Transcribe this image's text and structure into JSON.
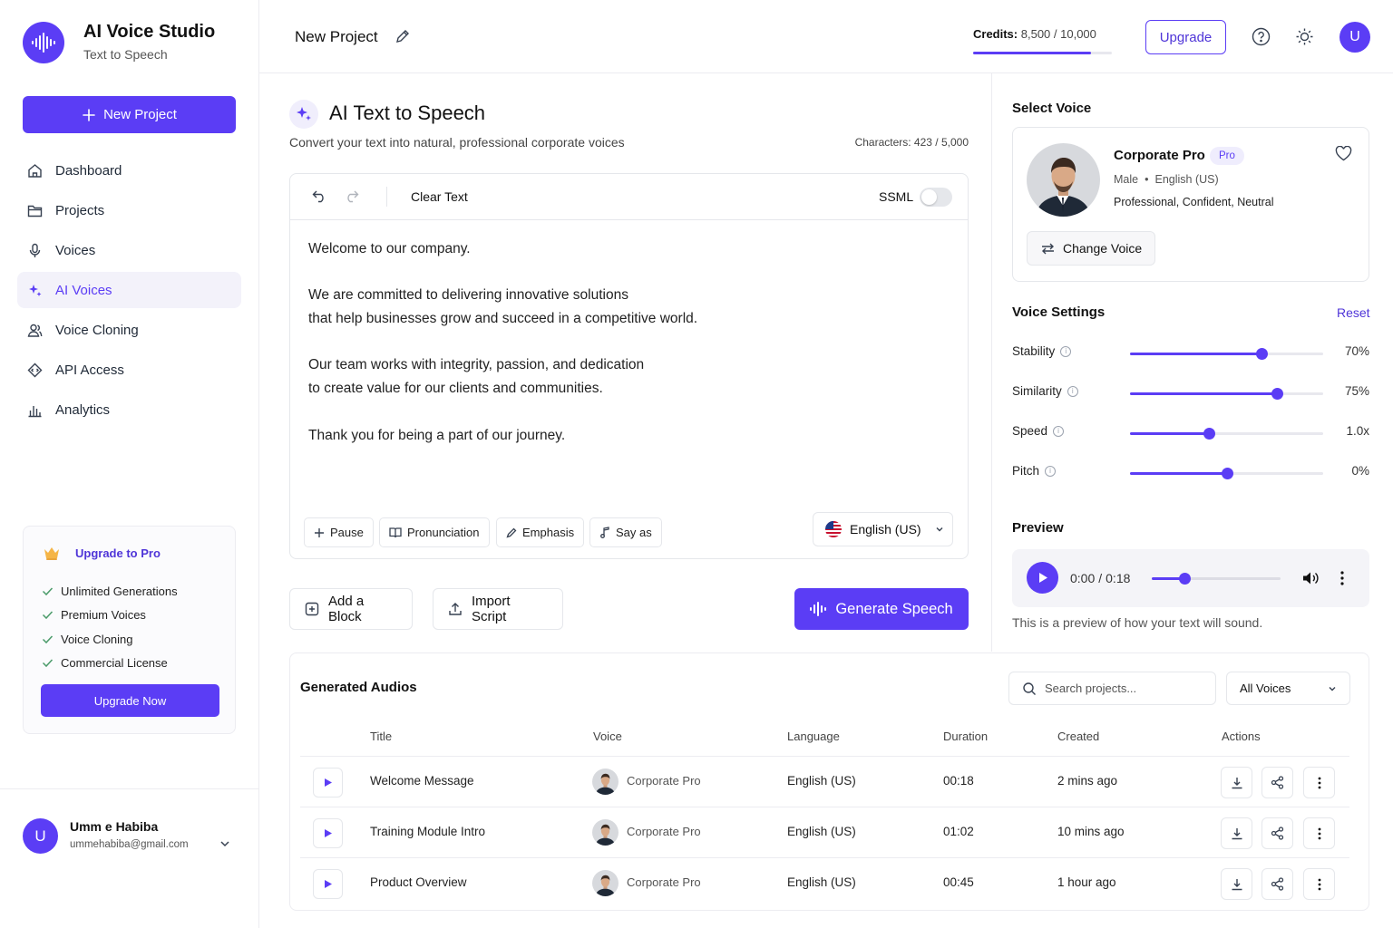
{
  "app": {
    "title": "AI Voice Studio",
    "subtitle": "Text to Speech"
  },
  "sidebar": {
    "new_project_label": "New Project",
    "items": [
      {
        "label": "Dashboard",
        "icon": "home-icon"
      },
      {
        "label": "Projects",
        "icon": "folder-icon"
      },
      {
        "label": "Voices",
        "icon": "microphone-icon"
      },
      {
        "label": "AI Voices",
        "icon": "sparkle-icon",
        "active": true
      },
      {
        "label": "Voice Cloning",
        "icon": "users-icon"
      },
      {
        "label": "API Access",
        "icon": "code-icon"
      },
      {
        "label": "Analytics",
        "icon": "bar-chart-icon"
      }
    ],
    "promo": {
      "title": "Upgrade to Pro",
      "features": [
        "Unlimited Generations",
        "Premium Voices",
        "Voice Cloning",
        "Commercial License"
      ],
      "button": "Upgrade Now"
    },
    "user": {
      "initial": "U",
      "name": "Umm e Habiba",
      "email": "ummehabiba@gmail.com"
    }
  },
  "header": {
    "project_title": "New Project",
    "credits_label": "Credits:",
    "credits_value": "8,500 / 10,000",
    "credits_fraction": 0.85,
    "upgrade_label": "Upgrade",
    "avatar_initial": "U"
  },
  "main": {
    "title": "AI Text to Speech",
    "subtitle": "Convert your text into natural, professional corporate voices",
    "characters": "Characters: 423 / 5,000",
    "toolbar": {
      "clear_text": "Clear Text",
      "ssml_label": "SSML",
      "ssml_on": false
    },
    "text_lines": [
      "Welcome to our company.",
      "",
      "We are committed to delivering innovative solutions",
      "that help businesses grow and succeed in a competitive world.",
      "",
      "Our team works with integrity, passion, and dedication",
      "to create value for our clients and communities.",
      "",
      "Thank you for being a part of our journey."
    ],
    "chips": {
      "pause": "Pause",
      "pronunciation": "Pronunciation",
      "emphasis": "Emphasis",
      "say_as": "Say as"
    },
    "language": "English (US)",
    "add_block": "Add a Block",
    "import_script": "Import Script",
    "generate": "Generate Speech"
  },
  "voice_panel": {
    "select_voice_title": "Select Voice",
    "voice": {
      "name": "Corporate Pro",
      "badge": "Pro",
      "gender": "Male",
      "language": "English (US)",
      "traits": "Professional, Confident, Neutral"
    },
    "change_voice": "Change Voice",
    "settings_title": "Voice Settings",
    "reset": "Reset",
    "settings": [
      {
        "label": "Stability",
        "value": "70%",
        "level": 0.68
      },
      {
        "label": "Similarity",
        "value": "75%",
        "level": 0.76
      },
      {
        "label": "Speed",
        "value": "1.0x",
        "level": 0.41
      },
      {
        "label": "Pitch",
        "value": "0%",
        "level": 0.5
      }
    ],
    "preview_title": "Preview",
    "player": {
      "current": "0:00",
      "separator": "/",
      "total": "0:18",
      "progress": 0.25
    },
    "preview_caption": "This is a preview of how your text will sound."
  },
  "generated": {
    "title": "Generated Audios",
    "search_placeholder": "Search projects...",
    "filter": "All Voices",
    "columns": [
      "Title",
      "Voice",
      "Language",
      "Duration",
      "Created",
      "Actions"
    ],
    "rows": [
      {
        "title": "Welcome Message",
        "voice": "Corporate Pro",
        "language": "English (US)",
        "duration": "00:18",
        "created": "2 mins ago"
      },
      {
        "title": "Training Module Intro",
        "voice": "Corporate Pro",
        "language": "English (US)",
        "duration": "01:02",
        "created": "10 mins ago"
      },
      {
        "title": "Product Overview",
        "voice": "Corporate Pro",
        "language": "English (US)",
        "duration": "00:45",
        "created": "1 hour ago"
      }
    ]
  },
  "colors": {
    "accent": "#5b3df5",
    "border": "#e5e7eb",
    "muted": "#555555"
  }
}
